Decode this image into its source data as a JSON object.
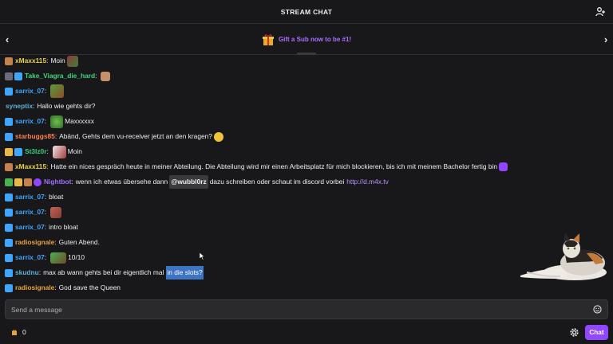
{
  "header": {
    "title": "STREAM CHAT",
    "users_icon": "users-icon"
  },
  "banner": {
    "text": "Gift a Sub now to be #1!",
    "left_arrow": "‹",
    "right_arrow": "›",
    "gift_icon": "gift-icon"
  },
  "colors": {
    "accent": "#9147ff",
    "link": "#bf94ff",
    "selection": "#3d74c4",
    "background": "#18181b"
  },
  "messages": [
    {
      "user": "xMaxx115",
      "color": "#e6d24a",
      "text": "Moin",
      "emote_after": true
    },
    {
      "user": "Take_Viagra_die_hard",
      "color": "#3ed67a",
      "text": "",
      "emote_after": true
    },
    {
      "user": "sarrix_07",
      "color": "#3ea6ff",
      "text": "",
      "emote_after": true
    },
    {
      "user": "syneptix",
      "color": "#5fb0d8",
      "text": "Hallo wie gehts dir?"
    },
    {
      "user": "sarrix_07",
      "color": "#3ea6ff",
      "text": "Maxxxxxx"
    },
    {
      "user": "starbuggs85",
      "color": "#ff7f50",
      "text": "Abänd, Gehts dem vu-receiver jetzt an den kragen?"
    },
    {
      "user": "St3lz0r",
      "color": "#33d17a",
      "text": "Moin"
    },
    {
      "user": "xMaxx115",
      "color": "#e6d24a",
      "text": "Hatte ein nices gespräch heute in meiner Abteilung. Die Abteilung wird mir einen Arbeitsplatz für mich blockieren, bis ich mit meinem Bachelor fertig bin"
    },
    {
      "user": "Nightbot",
      "color": "#9147ff",
      "text_before": "wenn ich etwas übersehe dann",
      "mention": "@wubbl0rz",
      "text_after": "dazu schreiben oder schaut im discord vorbei",
      "link": "http://d.m4x.tv"
    },
    {
      "user": "sarrix_07",
      "color": "#3ea6ff",
      "text": "bloat"
    },
    {
      "user": "sarrix_07",
      "color": "#3ea6ff",
      "text": ""
    },
    {
      "user": "sarrix_07",
      "color": "#3ea6ff",
      "text": "intro bloat"
    },
    {
      "user": "radiosignale",
      "color": "#e6a23c",
      "text": "Guten Abend."
    },
    {
      "user": "sarrix_07",
      "color": "#3ea6ff",
      "text": "10/10"
    },
    {
      "user": "skudnu",
      "color": "#5fb0d8",
      "text": "max ab wann gehts bei dir eigentlich mal",
      "highlight": "in die slots?"
    },
    {
      "user": "radiosignale",
      "color": "#e6a23c",
      "text": "God save the Queen"
    }
  ],
  "input": {
    "placeholder": "Send a message",
    "emote_icon": "smiley-icon"
  },
  "footer": {
    "points": "0",
    "points_icon": "channel-points-icon",
    "settings_icon": "gear-icon",
    "chat_button": "Chat"
  }
}
